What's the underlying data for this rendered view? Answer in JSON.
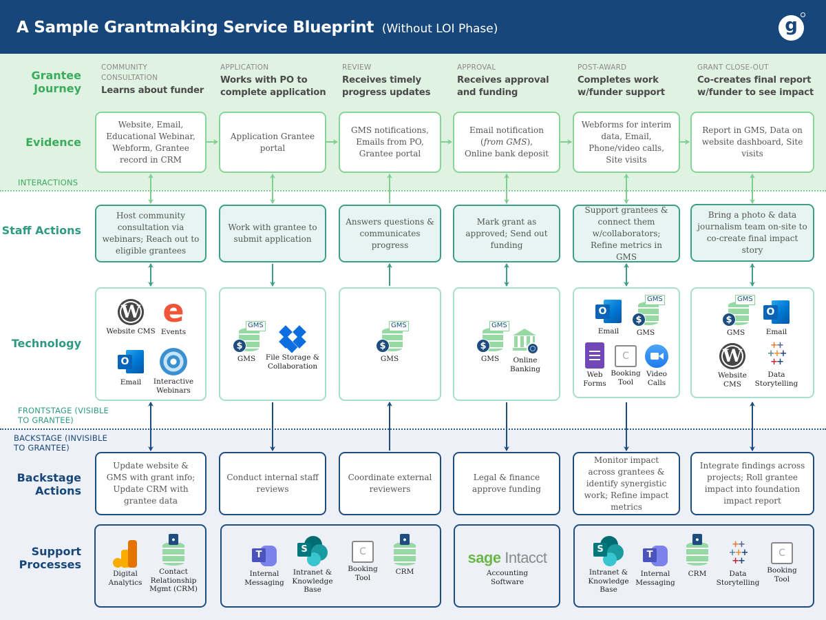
{
  "header": {
    "title": "A Sample Grantmaking Service Blueprint",
    "subtitle": "(Without LOI Phase)",
    "logo_letter": "g"
  },
  "colors": {
    "header_bg": "#17477a",
    "frontstage_green": "#3bab5e",
    "staff_teal": "#2f9a83",
    "backstage_navy": "#17477a",
    "green_band": "#e0f2e2",
    "blue_band": "#edf1f7"
  },
  "row_labels": {
    "journey": "Grantee Journey",
    "evidence": "Evidence",
    "staff": "Staff Actions",
    "technology": "Technology",
    "backstage": "Backstage Actions",
    "support": "Support Processes"
  },
  "lines": {
    "interactions": "INTERACTIONS",
    "frontstage": "FRONTSTAGE (VISIBLE TO GRANTEE)",
    "backstage": "BACKSTAGE (INVISIBLE TO GRANTEE)"
  },
  "phases": [
    {
      "kicker": "Community Consultation",
      "journey": "Learns about funder",
      "evidence": "Website, Email, Educational Webinar, Webform, Grantee record in CRM",
      "staff": "Host community consultation via webinars; Reach out to eligible grantees",
      "evidence_staff_arrow": "both",
      "staff_tech_arrow": "both",
      "tech_back_arrow": "both",
      "technology": [
        {
          "icon": "wordpress-icon",
          "label": "Website CMS"
        },
        {
          "icon": "eventbrite-icon",
          "label": "Events"
        },
        {
          "icon": "outlook-icon",
          "label": "Email"
        },
        {
          "icon": "webinar-icon",
          "label": "Interactive Webinars"
        }
      ],
      "backstage": "Update website & GMS with grant info; Update CRM with grantee data"
    },
    {
      "kicker": "Application",
      "journey": "Works with PO to complete application",
      "evidence": "Application Grantee portal",
      "staff": "Work with grantee to submit application",
      "evidence_staff_arrow": "both",
      "staff_tech_arrow": "down",
      "tech_back_arrow": "down",
      "technology": [
        {
          "icon": "gms-database-icon",
          "label": "GMS",
          "tag": "GMS"
        },
        {
          "icon": "dropbox-icon",
          "label": "File Storage & Collaboration"
        }
      ],
      "backstage": "Conduct internal staff reviews"
    },
    {
      "kicker": "Review",
      "journey": "Receives timely progress updates",
      "evidence": "GMS notifications, Emails from PO, Grantee portal",
      "staff": "Answers questions & communicates progress",
      "evidence_staff_arrow": "up",
      "staff_tech_arrow": "up",
      "tech_back_arrow": "up",
      "technology": [
        {
          "icon": "gms-database-icon",
          "label": "GMS",
          "tag": "GMS"
        }
      ],
      "backstage": "Coordinate external reviewers"
    },
    {
      "kicker": "Approval",
      "journey": "Receives approval and funding",
      "evidence_parts": [
        "Email notification",
        "(",
        "from GMS",
        "),",
        "Online bank deposit"
      ],
      "evidence": "Email notification (from GMS), Online bank deposit",
      "staff": "Mark grant as approved; Send out funding",
      "evidence_staff_arrow": "both",
      "staff_tech_arrow": "both",
      "tech_back_arrow": "down",
      "technology": [
        {
          "icon": "gms-database-icon",
          "label": "GMS",
          "tag": "GMS"
        },
        {
          "icon": "online-bank-icon",
          "label": "Online Banking"
        }
      ],
      "backstage": "Legal & finance approve funding"
    },
    {
      "kicker": "Post-Award",
      "journey": "Completes work w/funder support",
      "evidence": "Webforms for interim data, Email, Phone/video calls, Site visits",
      "staff": "Support grantees & connect them w/collaborators; Refine metrics in GMS",
      "evidence_staff_arrow": "both",
      "staff_tech_arrow": "both",
      "tech_back_arrow": "down",
      "technology": [
        {
          "icon": "outlook-icon",
          "label": "Email"
        },
        {
          "icon": "gms-database-icon",
          "label": "GMS",
          "tag": "GMS"
        },
        {
          "icon": "forms-icon",
          "label": "Web Forms"
        },
        {
          "icon": "booking-calendar-icon",
          "label": "Booking Tool",
          "glyph": "C"
        },
        {
          "icon": "zoom-video-icon",
          "label": "Video Calls"
        }
      ],
      "backstage": "Monitor impact across grantees & identify synergistic work; Refine impact metrics"
    },
    {
      "kicker": "Grant Close-Out",
      "journey": "Co-creates final report w/funder to see impact",
      "evidence": "Report in GMS, Data on website dashboard, Site visits",
      "staff": "Bring a photo & data journalism team on-site to co-create final impact story",
      "evidence_staff_arrow": "both",
      "staff_tech_arrow": "both",
      "tech_back_arrow": "both",
      "technology": [
        {
          "icon": "gms-database-icon",
          "label": "GMS",
          "tag": "GMS"
        },
        {
          "icon": "outlook-icon",
          "label": "Email"
        },
        {
          "icon": "wordpress-icon",
          "label": "Website CMS"
        },
        {
          "icon": "tableau-icon",
          "label": "Data Storytelling"
        }
      ],
      "backstage": "Integrate findings across projects; Roll grantee impact into foundation impact report"
    }
  ],
  "support_groups": [
    {
      "items": [
        {
          "icon": "google-analytics-icon",
          "label": "Digital Analytics"
        },
        {
          "icon": "crm-database-icon",
          "label": "Contact Relationship Mgmt (CRM)"
        }
      ]
    },
    {
      "items": [
        {
          "icon": "teams-icon",
          "label": "Internal Messaging",
          "glyph": "T"
        },
        {
          "icon": "sharepoint-icon",
          "label": "Intranet & Knowledge Base",
          "glyph": "S"
        },
        {
          "icon": "booking-calendar-icon",
          "label": "Booking Tool",
          "glyph": "C"
        },
        {
          "icon": "crm-database-icon",
          "label": "CRM"
        }
      ]
    },
    {
      "items": [
        {
          "icon": "sage-intacct-logo",
          "label": "Accounting Software",
          "brand_a": "sage",
          "brand_b": "Intacct"
        }
      ]
    },
    {
      "items": [
        {
          "icon": "sharepoint-icon",
          "label": "Intranet & Knowledge Base",
          "glyph": "S"
        },
        {
          "icon": "teams-icon",
          "label": "Internal Messaging",
          "glyph": "T"
        },
        {
          "icon": "crm-database-icon",
          "label": "CRM"
        },
        {
          "icon": "tableau-icon",
          "label": "Data Storytelling"
        },
        {
          "icon": "booking-calendar-icon",
          "label": "Booking Tool",
          "glyph": "C"
        }
      ]
    }
  ],
  "glyphs": {
    "wordpress": "W",
    "eventbrite": "e",
    "outlook": "O",
    "dollar": "$",
    "tableau": "+"
  }
}
